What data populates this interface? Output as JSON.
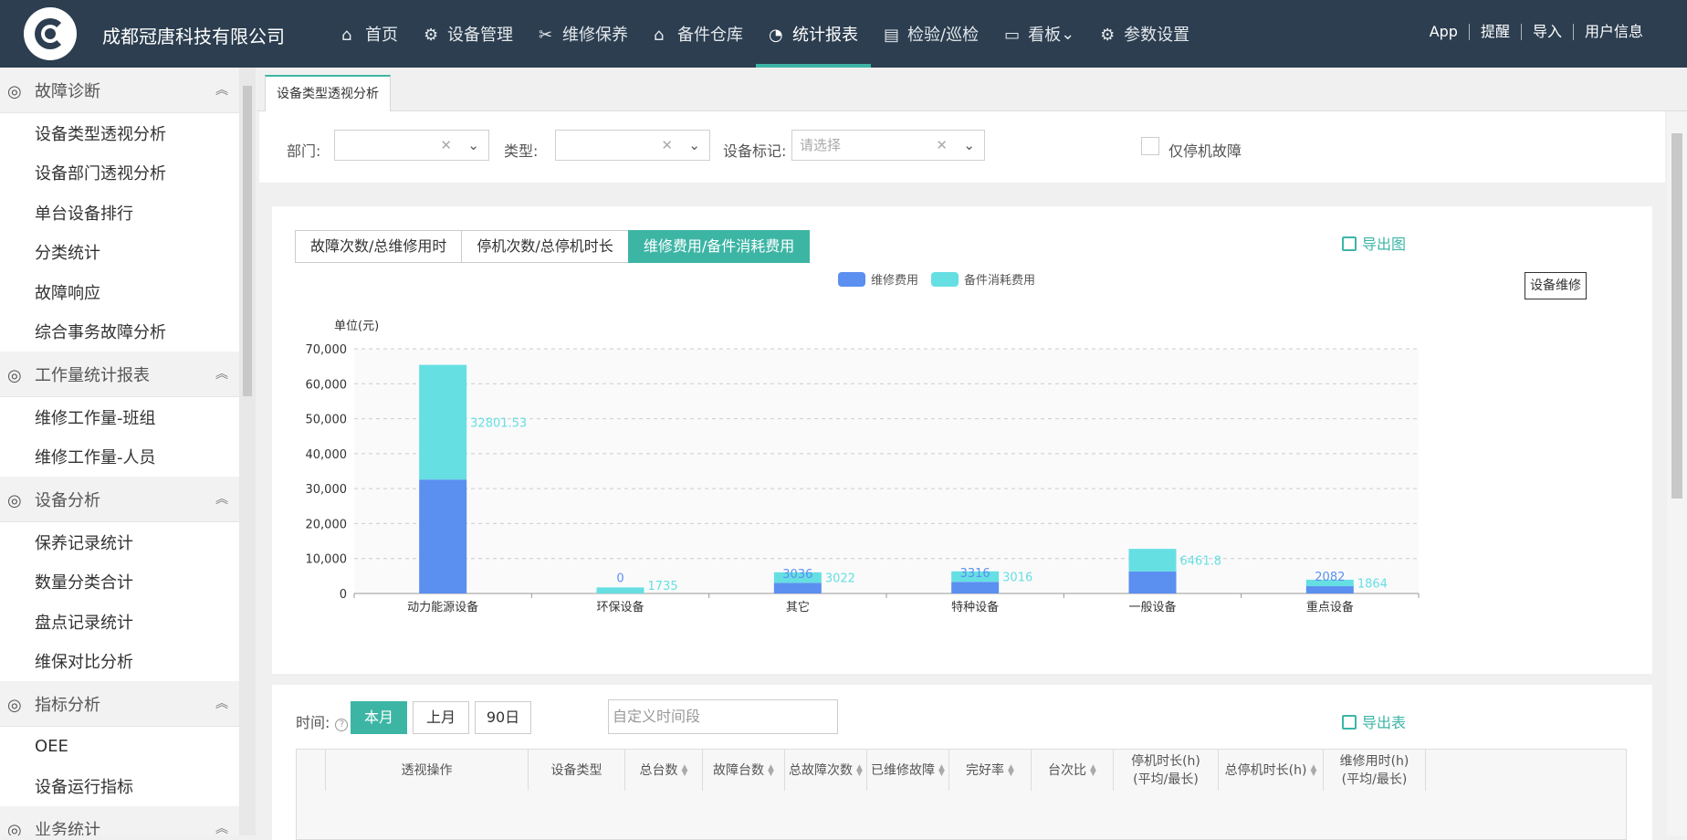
{
  "header": {
    "company": "成都冠唐科技有限公司",
    "nav": [
      {
        "label": "首页",
        "icon": "home-icon"
      },
      {
        "label": "设备管理",
        "icon": "device-icon"
      },
      {
        "label": "维修保养",
        "icon": "tools-icon"
      },
      {
        "label": "备件仓库",
        "icon": "warehouse-icon"
      },
      {
        "label": "统计报表",
        "icon": "pie-chart-icon",
        "active": true
      },
      {
        "label": "检验/巡检",
        "icon": "inspect-icon"
      },
      {
        "label": "看板",
        "icon": "board-icon"
      },
      {
        "label": "参数设置",
        "icon": "gear-icon"
      }
    ],
    "right_links": [
      "App",
      "提醒",
      "导入",
      "用户信息"
    ]
  },
  "sidebar": {
    "groups": [
      {
        "title": "故障诊断",
        "icon": "diagnosis-icon",
        "items": [
          "设备类型透视分析",
          "设备部门透视分析",
          "单台设备排行",
          "分类统计",
          "故障响应",
          "综合事务故障分析"
        ]
      },
      {
        "title": "工作量统计报表",
        "icon": "workload-icon",
        "items": [
          "维修工作量-班组",
          "维修工作量-人员"
        ]
      },
      {
        "title": "设备分析",
        "icon": "monitor-icon",
        "items": [
          "保养记录统计",
          "数量分类合计",
          "盘点记录统计",
          "维保对比分析"
        ]
      },
      {
        "title": "指标分析",
        "icon": "gauge-icon",
        "items": [
          "OEE",
          "设备运行指标"
        ]
      },
      {
        "title": "业务统计",
        "icon": "stats-icon",
        "items": []
      }
    ]
  },
  "tab": {
    "label": "设备类型透视分析"
  },
  "filter": {
    "dept_label": "部门:",
    "type_label": "类型:",
    "mark_label": "设备标记:",
    "mark_placeholder": "请选择",
    "only_downtime_label": "仅停机故障"
  },
  "chart_panel": {
    "buttons": [
      "故障次数/总维修用时",
      "停机次数/总停机时长",
      "维修费用/备件消耗费用"
    ],
    "active_button": 2,
    "export_label": "导出图",
    "tooltip": "设备维修"
  },
  "chart_data": {
    "type": "bar",
    "stacked": true,
    "unit_label": "单位(元)",
    "categories": [
      "动力能源设备",
      "环保设备",
      "其它",
      "特种设备",
      "一般设备",
      "重点设备"
    ],
    "series": [
      {
        "name": "维修费用",
        "color": "#5b8ff0",
        "values": [
          32600,
          0,
          3036,
          3316,
          6300,
          2082
        ]
      },
      {
        "name": "备件消耗费用",
        "color": "#66dfe3",
        "values": [
          32801.53,
          1735,
          3022,
          3016,
          6461.8,
          1864
        ]
      }
    ],
    "data_labels": {
      "维修费用": [
        null,
        "0",
        "3036",
        "3316",
        null,
        "2082"
      ],
      "备件消耗费用": [
        "32801.53",
        "1735",
        "3022",
        "3016",
        "6461.8",
        "1864"
      ]
    },
    "ylim": [
      0,
      70000
    ],
    "yticks": [
      "0",
      "10,000",
      "20,000",
      "30,000",
      "40,000",
      "50,000",
      "60,000",
      "70,000"
    ],
    "grid": true,
    "legend": "top-center"
  },
  "table_panel": {
    "time_label": "时间:",
    "help": "?",
    "buttons": [
      "本月",
      "上月",
      "90日"
    ],
    "active_button": 0,
    "custom_placeholder": "自定义时间段",
    "export_label": "导出表",
    "columns": [
      "透视操作",
      "设备类型",
      "总台数",
      "故障台数",
      "总故障次数",
      "已维修故障",
      "完好率",
      "台次比",
      "停机时长(h)\n(平均/最长)",
      "总停机时长(h)",
      "维修用时(h)\n(平均/最长)"
    ]
  }
}
